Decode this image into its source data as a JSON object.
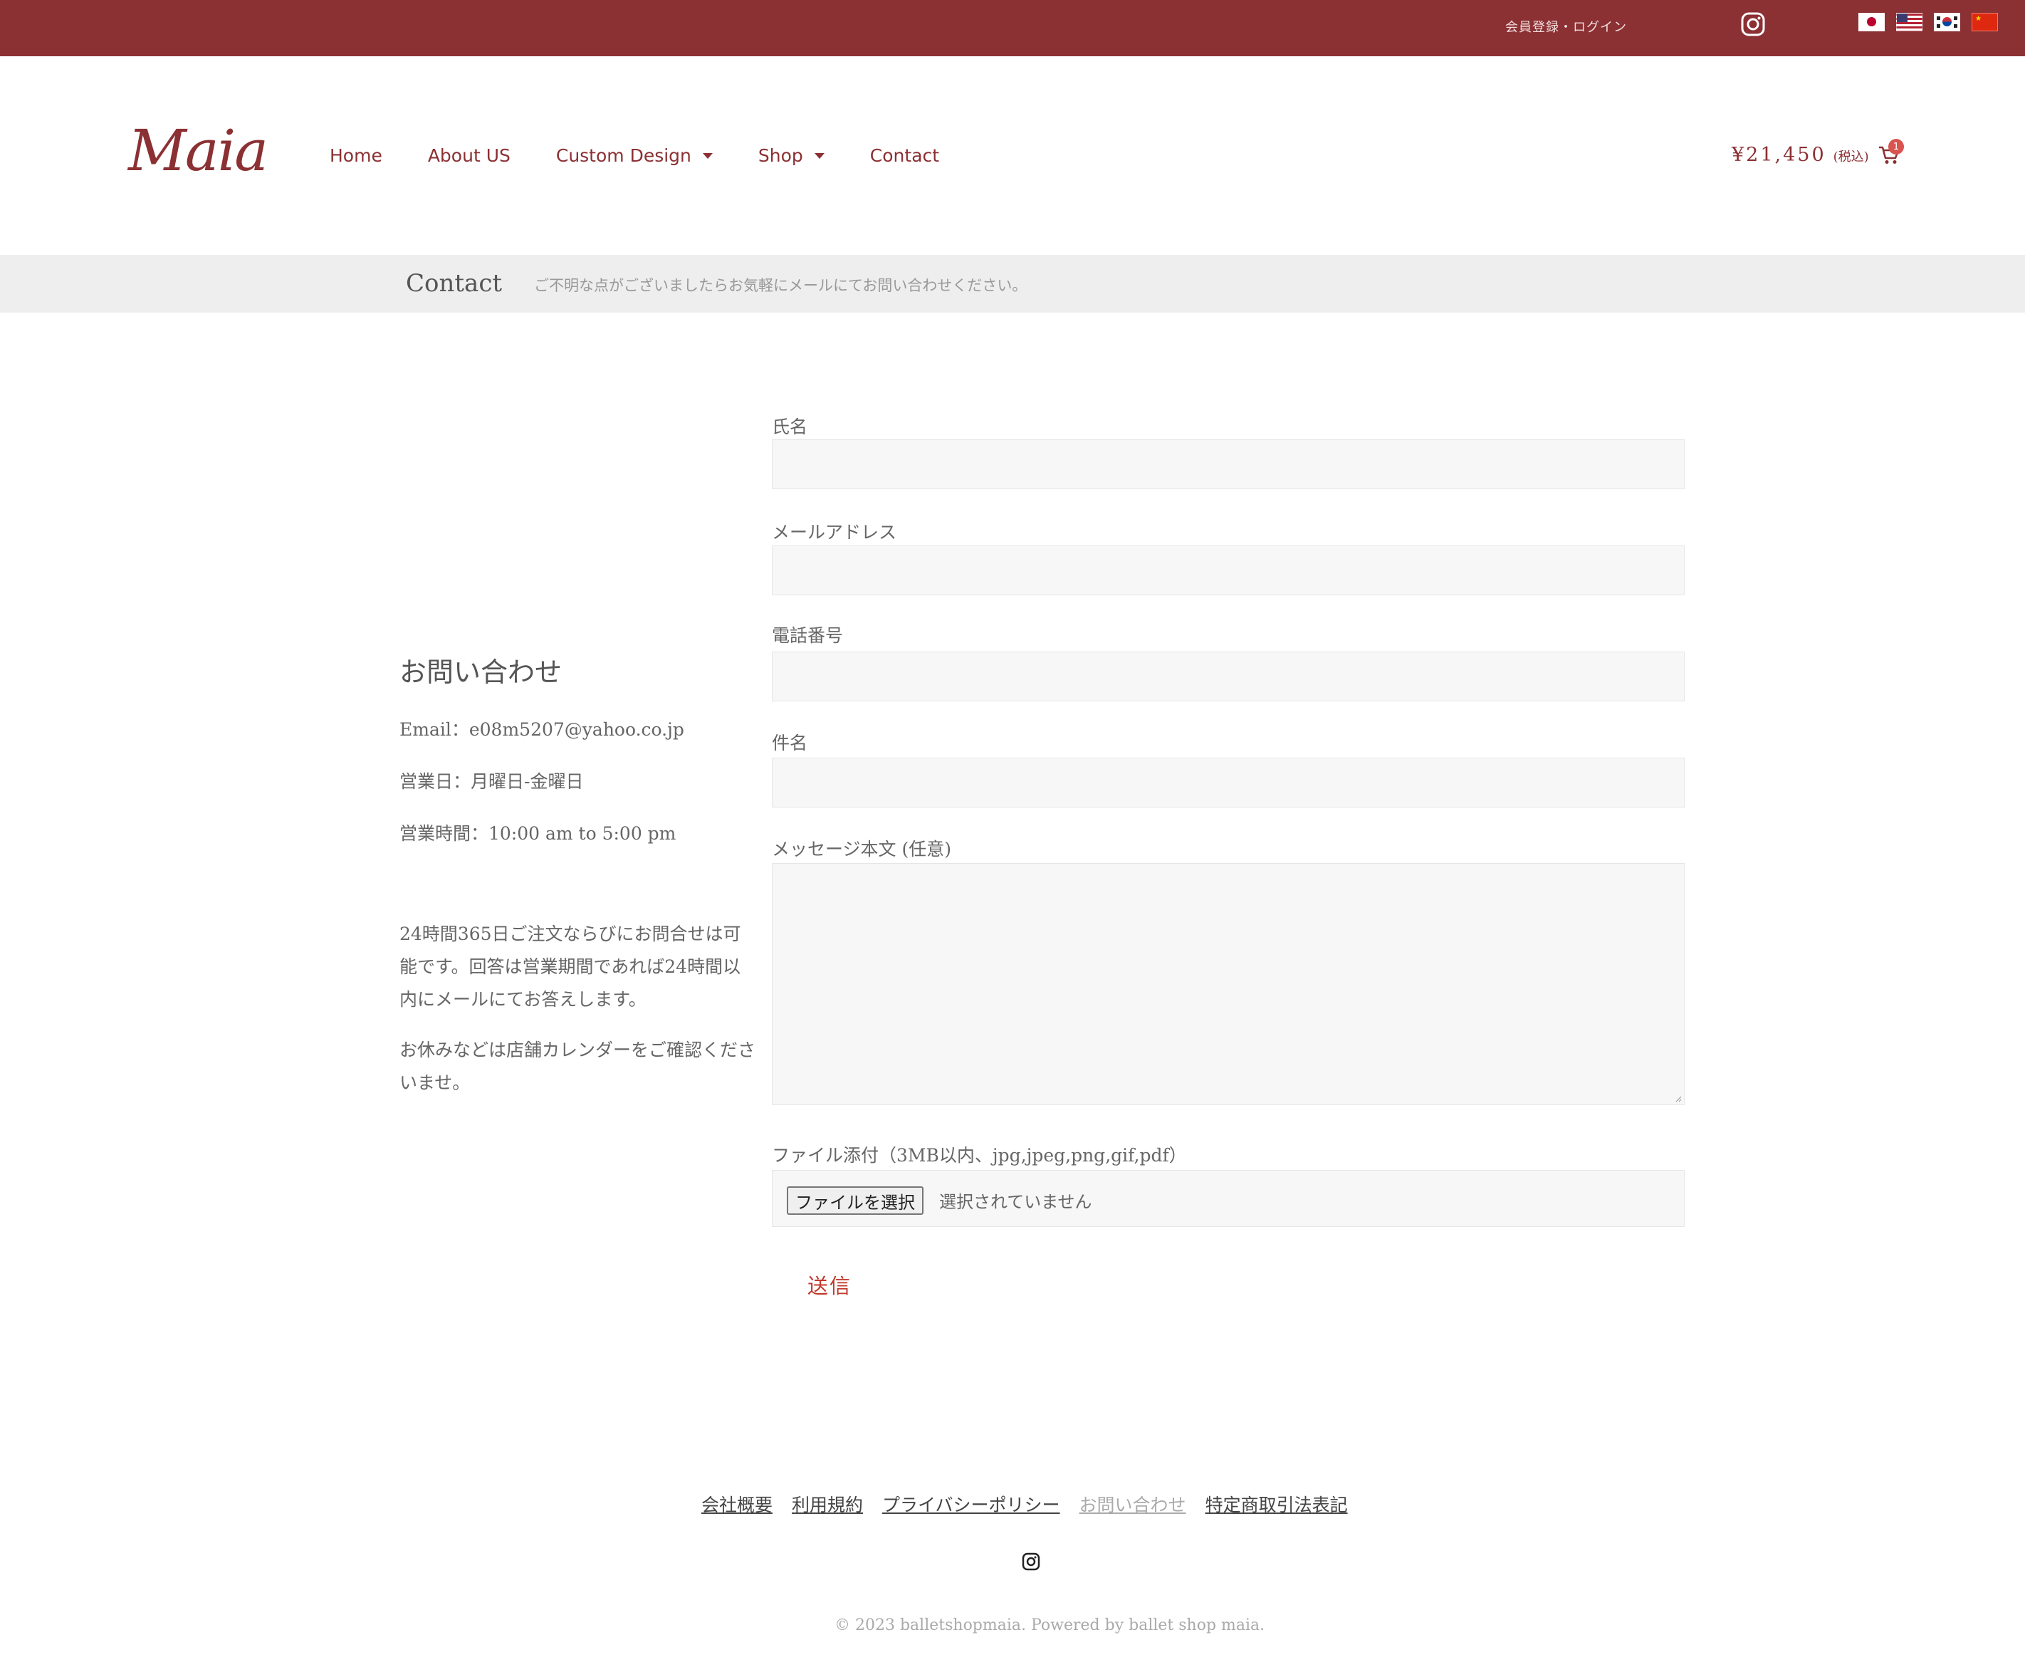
{
  "topbar": {
    "account_link": "会員登録・ログイン",
    "instagram_icon": "instagram-icon",
    "flags": [
      "japan-flag-icon",
      "usa-flag-icon",
      "korea-flag-icon",
      "china-flag-icon"
    ],
    "background": "#8b3033"
  },
  "header": {
    "logo": "Maia",
    "nav": [
      {
        "label": "Home",
        "dropdown": false
      },
      {
        "label": "About US",
        "dropdown": false
      },
      {
        "label": "Custom Design",
        "dropdown": true
      },
      {
        "label": "Shop",
        "dropdown": true
      },
      {
        "label": "Contact",
        "dropdown": false
      }
    ],
    "cart": {
      "price": "¥21,450",
      "tax": "(税込)",
      "count": "1",
      "icon": "cart-icon"
    },
    "accent": "#8b3033"
  },
  "page": {
    "title": "Contact",
    "subtitle": "ご不明な点がございましたらお気軽にメールにてお問い合わせください。"
  },
  "info": {
    "heading": "お問い合わせ",
    "email": "Email：e08m5207@yahoo.co.jp",
    "business_days": "営業日：月曜日-金曜日",
    "business_hours": "営業時間：10:00 am to 5:00 pm",
    "para1": "24時間365日ご注文ならびにお問合せは可能です。回答は営業期間であれば24時間以内にメールにてお答えします。",
    "para2": "お休みなどは店舗カレンダーをご確認くださいませ。"
  },
  "form": {
    "name_label": "氏名",
    "email_label": "メールアドレス",
    "phone_label": "電話番号",
    "subject_label": "件名",
    "message_label": "メッセージ本文 (任意)",
    "file_label": "ファイル添付（3MB以内、jpg,jpeg,png,gif,pdf）",
    "file_button": "ファイルを選択",
    "file_status": "選択されていません",
    "submit": "送信",
    "name_value": "",
    "email_value": "",
    "phone_value": "",
    "subject_value": "",
    "message_value": ""
  },
  "footer": {
    "links": [
      {
        "label": "会社概要",
        "muted": false
      },
      {
        "label": "利用規約",
        "muted": false
      },
      {
        "label": "プライバシーポリシー",
        "muted": false
      },
      {
        "label": "お問い合わせ",
        "muted": true
      },
      {
        "label": "特定商取引法表記",
        "muted": false
      }
    ],
    "instagram_icon": "instagram-icon",
    "copyright": "© 2023 balletshopmaia. Powered by ballet shop maia."
  }
}
